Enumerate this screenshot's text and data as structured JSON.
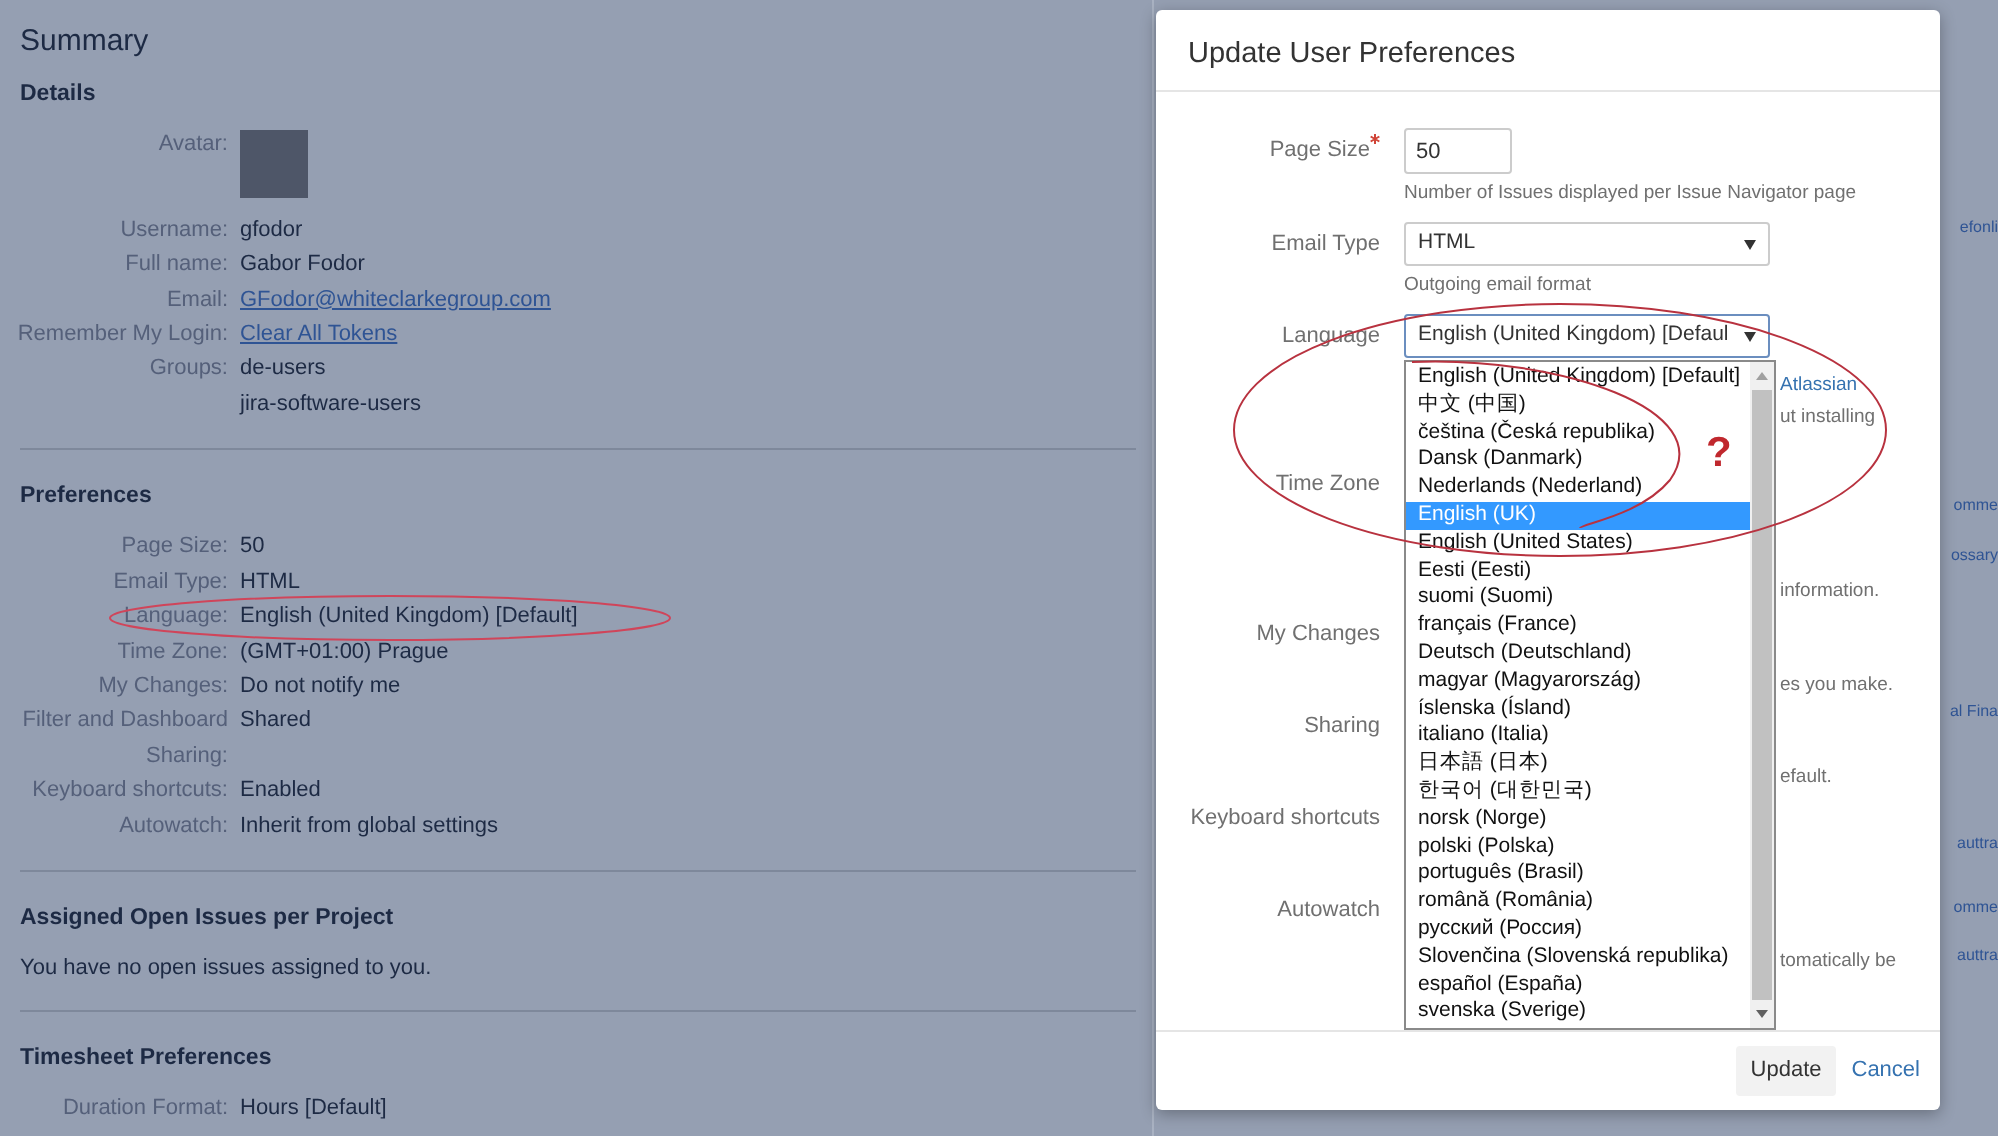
{
  "summary": {
    "title": "Summary",
    "details": {
      "heading": "Details",
      "avatar_label": "Avatar:",
      "rows": [
        {
          "label": "Username:",
          "kind": "text",
          "values": [
            "gfodor"
          ]
        },
        {
          "label": "Full name:",
          "kind": "text",
          "values": [
            "Gabor Fodor"
          ]
        },
        {
          "label": "Email:",
          "kind": "link",
          "values": [
            "GFodor@whiteclarkegroup.com"
          ]
        },
        {
          "label": "Remember My Login:",
          "kind": "link",
          "values": [
            "Clear All Tokens"
          ]
        },
        {
          "label": "Groups:",
          "kind": "text",
          "values": [
            "de-users",
            "jira-software-users"
          ]
        }
      ]
    },
    "preferences": {
      "heading": "Preferences",
      "rows": [
        {
          "label": "Page Size:",
          "values": [
            "50"
          ]
        },
        {
          "label": "Email Type:",
          "values": [
            "HTML"
          ]
        },
        {
          "label": "Language:",
          "values": [
            "English (United Kingdom) [Default]"
          ]
        },
        {
          "label": "Time Zone:",
          "values": [
            "(GMT+01:00) Prague"
          ]
        },
        {
          "label": "My Changes:",
          "values": [
            "Do not notify me"
          ]
        },
        {
          "label": "Filter and Dashboard Sharing:",
          "values": [
            "Shared"
          ]
        },
        {
          "label": "Keyboard shortcuts:",
          "values": [
            "Enabled"
          ]
        },
        {
          "label": "Autowatch:",
          "values": [
            "Inherit from global settings"
          ]
        }
      ]
    },
    "assigned": {
      "heading": "Assigned Open Issues per Project",
      "text": "You have no open issues assigned to you."
    },
    "timesheet": {
      "heading": "Timesheet Preferences",
      "rows": [
        {
          "label": "Duration Format:",
          "values": [
            "Hours [Default]"
          ]
        }
      ]
    }
  },
  "background_fragments": [
    "efonli",
    "omme",
    "ossary",
    "al Fina",
    "auttra",
    "omme",
    "auttra"
  ],
  "dialog": {
    "title": "Update User Preferences",
    "fields": [
      {
        "label": "Page Size",
        "kind": "input",
        "required": true,
        "value": "50",
        "hints": [
          "Number of Issues displayed per Issue Navigator page"
        ]
      },
      {
        "label": "Email Type",
        "kind": "select",
        "value": "HTML",
        "hints": [
          "Outgoing email format"
        ]
      },
      {
        "label": "Language",
        "kind": "select",
        "value": "English (United Kingdom) [Defaul",
        "hints": [
          "Atlassian",
          "ut installing"
        ]
      },
      {
        "label": "Time Zone",
        "kind": "covered",
        "hints": [
          "information."
        ]
      },
      {
        "label": "My Changes",
        "kind": "covered",
        "hints": [
          "es you make."
        ]
      },
      {
        "label": "Sharing",
        "kind": "covered",
        "hints": [
          "efault."
        ]
      },
      {
        "label": "Keyboard shortcuts",
        "kind": "covered"
      },
      {
        "label": "Autowatch",
        "kind": "covered",
        "hints": [
          "tomatically be"
        ]
      }
    ],
    "dropdown": [
      {
        "label": "English (United Kingdom) [Default]",
        "selected": false
      },
      {
        "label": "中文 (中国)",
        "selected": false
      },
      {
        "label": "čeština (Česká republika)",
        "selected": false
      },
      {
        "label": "Dansk (Danmark)",
        "selected": false
      },
      {
        "label": "Nederlands (Nederland)",
        "selected": false
      },
      {
        "label": "English (UK)",
        "selected": true
      },
      {
        "label": "English (United States)",
        "selected": false
      },
      {
        "label": "Eesti (Eesti)",
        "selected": false
      },
      {
        "label": "suomi (Suomi)",
        "selected": false
      },
      {
        "label": "français (France)",
        "selected": false
      },
      {
        "label": "Deutsch (Deutschland)",
        "selected": false
      },
      {
        "label": "magyar (Magyarország)",
        "selected": false
      },
      {
        "label": "íslenska (Ísland)",
        "selected": false
      },
      {
        "label": "italiano (Italia)",
        "selected": false
      },
      {
        "label": "日本語 (日本)",
        "selected": false
      },
      {
        "label": "한국어 (대한민국)",
        "selected": false
      },
      {
        "label": "norsk (Norge)",
        "selected": false
      },
      {
        "label": "polski (Polska)",
        "selected": false
      },
      {
        "label": "português (Brasil)",
        "selected": false
      },
      {
        "label": "română (România)",
        "selected": false
      },
      {
        "label": "русский (Россия)",
        "selected": false
      },
      {
        "label": "Slovenčina (Slovenská republika)",
        "selected": false
      },
      {
        "label": "español (España)",
        "selected": false
      },
      {
        "label": "svenska (Sverige)",
        "selected": false
      }
    ],
    "buttons": [
      {
        "label": "Update",
        "kind": "primary"
      },
      {
        "label": "Cancel",
        "kind": "link"
      }
    ]
  },
  "annotation": {
    "mark": "?"
  }
}
